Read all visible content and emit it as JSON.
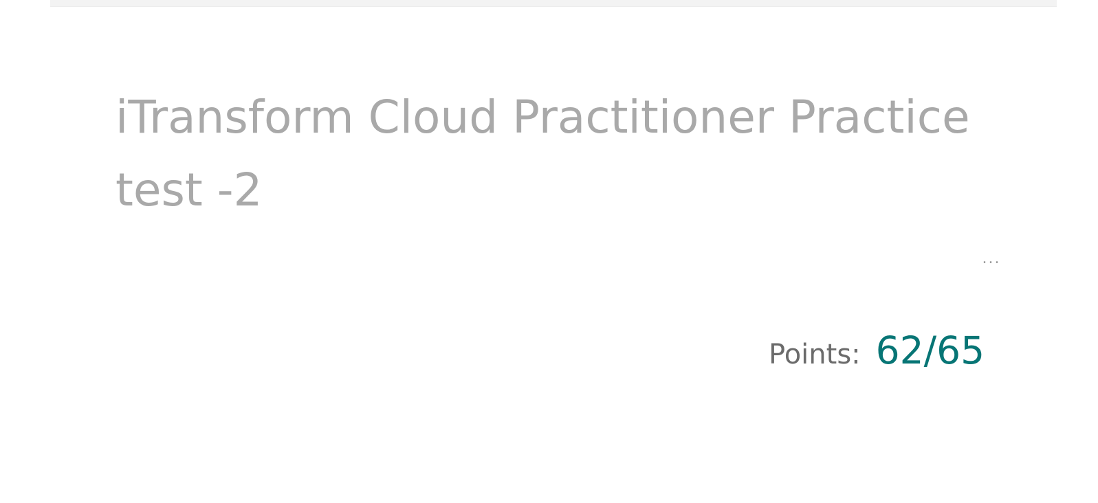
{
  "form": {
    "title": "iTransform Cloud Practitioner Practice test -2"
  },
  "actions": {
    "more_label": "..."
  },
  "score": {
    "label": "Points:",
    "value": "62/65"
  },
  "colors": {
    "accent": "#077575",
    "title_text": "#a9a9a9",
    "label_text": "#6b6b6b"
  }
}
